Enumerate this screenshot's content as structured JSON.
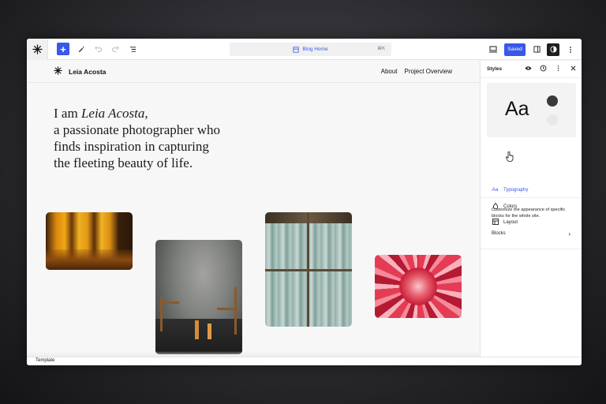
{
  "toolbar": {
    "logo_icon": "asterisk-logo-icon",
    "add_label": "+",
    "document_title": "Blog Home",
    "shortcut": "⌘K",
    "save_label": "Saved"
  },
  "site": {
    "title": "Leia Acosta",
    "nav": [
      "About",
      "Project Overview"
    ]
  },
  "hero": {
    "line1_prefix": "I am ",
    "line1_name": "Leia Acosta",
    "line1_suffix": ",",
    "line2": "a passionate photographer who",
    "line3": "finds inspiration in capturing",
    "line4": "the fleeting beauty of life."
  },
  "panel": {
    "title": "Styles",
    "preview_text": "Aa",
    "items": [
      {
        "icon": "typography-icon",
        "glyph": "Aa",
        "label": "Typography"
      },
      {
        "icon": "colors-icon",
        "glyph": "◇",
        "label": "Colors"
      },
      {
        "icon": "layout-icon",
        "glyph": "▣",
        "label": "Layout"
      }
    ],
    "description": "Customize the appearance of specific blocks for the whole site.",
    "blocks_label": "Blocks"
  },
  "status": {
    "label": "Template"
  },
  "colors": {
    "accent": "#3858e9",
    "panel_bg": "#ffffff",
    "canvas_bg": "#f7f7f7"
  }
}
